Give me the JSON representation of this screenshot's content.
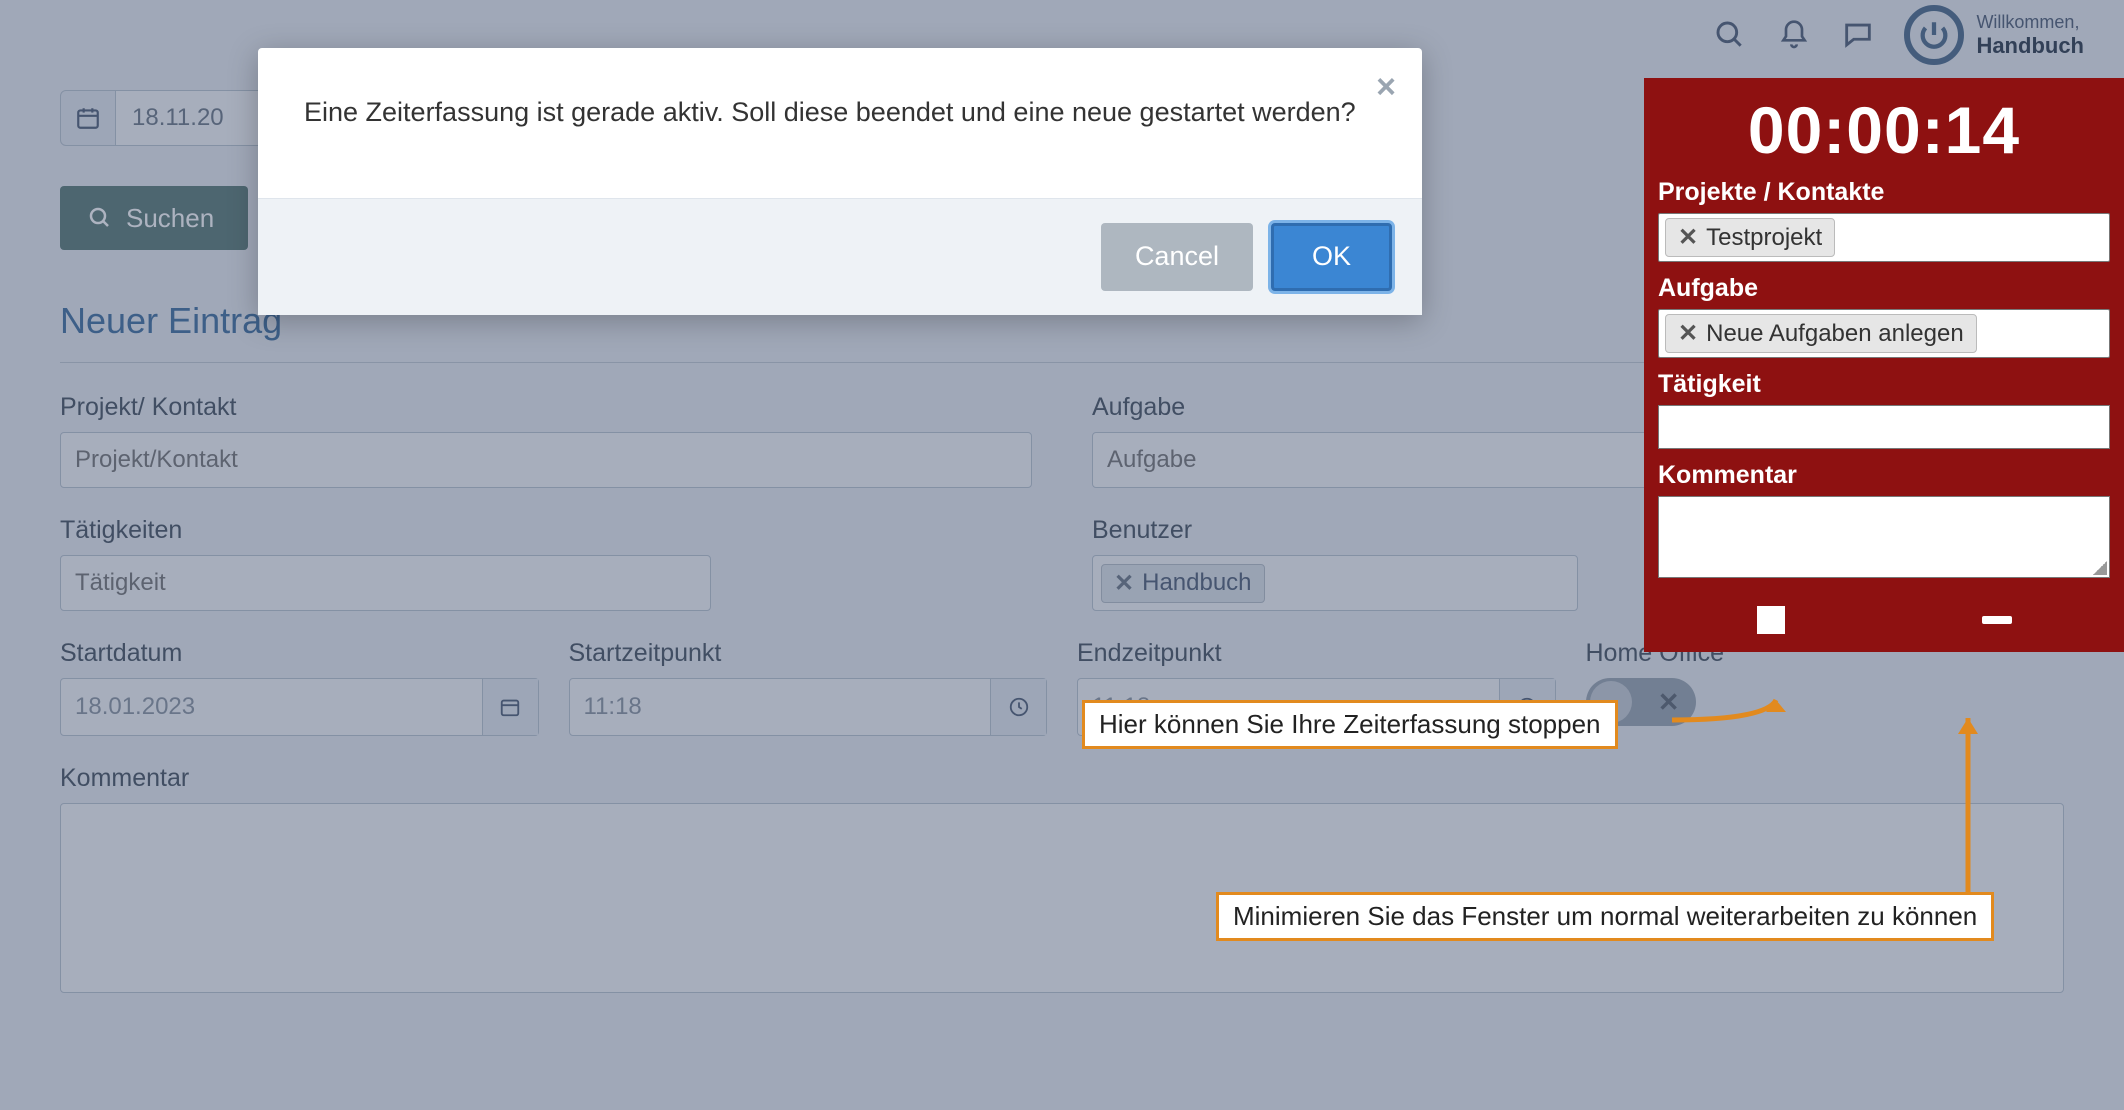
{
  "header": {
    "welcome_small": "Willkommen,",
    "welcome_name": "Handbuch"
  },
  "page": {
    "date_value": "18.11.20",
    "search_label": "Suchen",
    "section_title": "Neuer Eintrag",
    "project_label": "Projekt/ Kontakt",
    "project_placeholder": "Projekt/Kontakt",
    "aufgabe_label": "Aufgabe",
    "aufgabe_placeholder": "Aufgabe",
    "taetigkeiten_label": "Tätigkeiten",
    "taetigkeit_placeholder": "Tätigkeit",
    "benutzer_label": "Benutzer",
    "benutzer_tag": "Handbuch",
    "startdatum_label": "Startdatum",
    "startdatum_value": "18.01.2023",
    "startzeit_label": "Startzeitpunkt",
    "startzeit_value": "11:18",
    "endzeit_label": "Endzeitpunkt",
    "endzeit_value": "11:18",
    "homeoffice_label": "Home Office",
    "kommentar_label": "Kommentar"
  },
  "modal": {
    "message": "Eine Zeiterfassung ist gerade aktiv. Soll diese beendet und eine neue gestartet werden?",
    "cancel": "Cancel",
    "ok": "OK"
  },
  "timer": {
    "time": "00:00:14",
    "projekte_label": "Projekte / Kontakte",
    "projekt_tag": "Testprojekt",
    "aufgabe_label": "Aufgabe",
    "aufgabe_tag": "Neue Aufgaben anlegen",
    "taetigkeit_label": "Tätigkeit",
    "kommentar_label": "Kommentar"
  },
  "callouts": {
    "stop": "Hier können Sie Ihre Zeiterfassung stoppen",
    "minimize": "Minimieren Sie das Fenster um normal weiterarbeiten zu können"
  }
}
